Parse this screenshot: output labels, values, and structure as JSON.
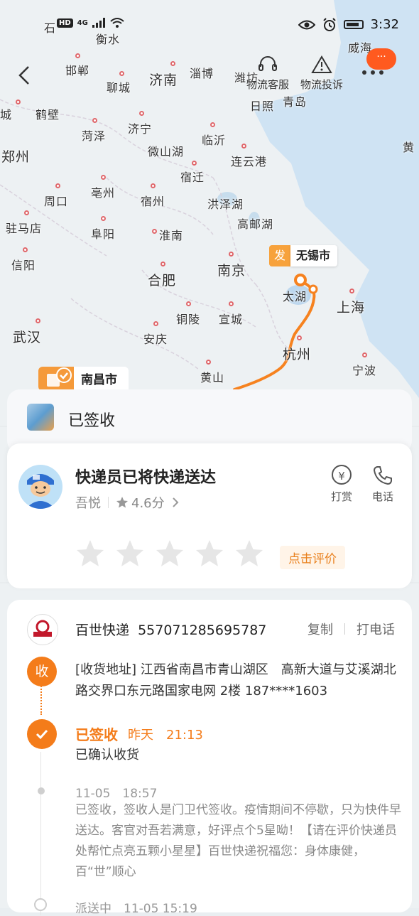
{
  "status_bar": {
    "time": "3:32",
    "network": "4G",
    "hd": "HD"
  },
  "top_actions": {
    "service": "物流客服",
    "complaint": "物流投诉",
    "bubble": "···"
  },
  "map": {
    "origin_tag": "发",
    "origin_city": "无锡市",
    "dest_city": "南昌市",
    "cities": [
      {
        "name": "衡水",
        "id": "c1"
      },
      {
        "name": "邯郸",
        "id": "c2"
      },
      {
        "name": "济南",
        "id": "c3"
      },
      {
        "name": "淄博",
        "id": "c4"
      },
      {
        "name": "潍坊",
        "id": "c5"
      },
      {
        "name": "威海",
        "id": "c6"
      },
      {
        "name": "聊城",
        "id": "c7"
      },
      {
        "name": "日照",
        "id": "c8"
      },
      {
        "name": "青岛",
        "id": "c9"
      },
      {
        "name": "鹤壁",
        "id": "c10"
      },
      {
        "name": "菏泽",
        "id": "c11"
      },
      {
        "name": "济宁",
        "id": "c12"
      },
      {
        "name": "临沂",
        "id": "c13"
      },
      {
        "name": "郑州",
        "id": "c14"
      },
      {
        "name": "微山湖",
        "id": "c15"
      },
      {
        "name": "连云港",
        "id": "c16"
      },
      {
        "name": "宿迁",
        "id": "c17"
      },
      {
        "name": "周口",
        "id": "c18"
      },
      {
        "name": "亳州",
        "id": "c19"
      },
      {
        "name": "宿州",
        "id": "c20"
      },
      {
        "name": "洪泽湖",
        "id": "c21"
      },
      {
        "name": "驻马店",
        "id": "c22"
      },
      {
        "name": "阜阳",
        "id": "c23"
      },
      {
        "name": "淮南",
        "id": "c24"
      },
      {
        "name": "高邮湖",
        "id": "c25"
      },
      {
        "name": "信阳",
        "id": "c26"
      },
      {
        "name": "合肥",
        "id": "c27"
      },
      {
        "name": "南京",
        "id": "c28"
      },
      {
        "name": "太湖",
        "id": "c29"
      },
      {
        "name": "上海",
        "id": "c30"
      },
      {
        "name": "铜陵",
        "id": "c31"
      },
      {
        "name": "宣城",
        "id": "c32"
      },
      {
        "name": "武汉",
        "id": "c33"
      },
      {
        "name": "安庆",
        "id": "c34"
      },
      {
        "name": "杭州",
        "id": "c35"
      },
      {
        "name": "黄山",
        "id": "c36"
      },
      {
        "name": "宁波",
        "id": "c37"
      },
      {
        "name": "黄",
        "id": "c38"
      },
      {
        "name": "城",
        "id": "c39"
      },
      {
        "name": "石",
        "id": "c40"
      }
    ]
  },
  "signed_card": {
    "title": "已签收"
  },
  "courier_card": {
    "title": "快递员已将快递送达",
    "courier_name": "吾悦",
    "rating": "4.6分",
    "tip_label": "打赏",
    "tip_symbol": "¥",
    "call_label": "电话",
    "rate_button": "点击评价"
  },
  "detail_card": {
    "company": "百世快递",
    "tracking_no": "557071285695787",
    "copy": "复制",
    "call": "打电话",
    "address_badge": "收",
    "address": "[收货地址] 江西省南昌市青山湖区　高新大道与艾溪湖北路交界口东元路国家电网 2楼 187****1603",
    "done_title": "已签收",
    "done_time": "昨天　21:13",
    "done_sub": "已确认收货",
    "event_time": "11-05　18:57",
    "event_text": "已签收，签收人是门卫代签收。疫情期间不停歇，只为快件早送达。客官对吾若满意，好评点个5星呦！【请在评价快递员处帮忙点亮五颗小星星】百世快递祝福您：身体康健，百“世”顺心",
    "next_event": "派送中　11-05 15:19"
  },
  "colors": {
    "accent": "#f47c1a",
    "route": "#f6821f",
    "bubble": "#ff5a1f"
  }
}
